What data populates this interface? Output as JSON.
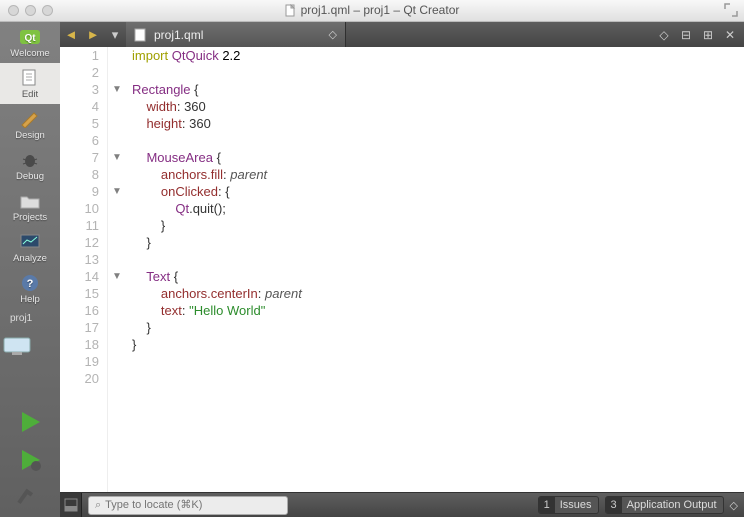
{
  "window": {
    "title": "proj1.qml – proj1 – Qt Creator"
  },
  "sidebar": {
    "items": [
      {
        "id": "welcome",
        "label": "Welcome"
      },
      {
        "id": "edit",
        "label": "Edit"
      },
      {
        "id": "design",
        "label": "Design"
      },
      {
        "id": "debug",
        "label": "Debug"
      },
      {
        "id": "projects",
        "label": "Projects"
      },
      {
        "id": "analyze",
        "label": "Analyze"
      },
      {
        "id": "help",
        "label": "Help"
      }
    ],
    "project_label": "proj1"
  },
  "tabs": {
    "file_name": "proj1.qml"
  },
  "locator": {
    "placeholder": "Type to locate (⌘K)"
  },
  "bottom_panels": {
    "issues": {
      "num": "1",
      "label": "Issues"
    },
    "app_output": {
      "num": "3",
      "label": "Application Output"
    }
  },
  "editor": {
    "lines": [
      {
        "n": 1,
        "tokens": [
          [
            "kw",
            "import"
          ],
          [
            "",
            ""
          ],
          [
            "type",
            " QtQuick"
          ],
          [
            "",
            " 2.2"
          ]
        ]
      },
      {
        "n": 2,
        "tokens": []
      },
      {
        "n": 3,
        "fold": true,
        "tokens": [
          [
            "type",
            "Rectangle"
          ],
          [
            "",
            " "
          ],
          [
            "punct",
            "{"
          ]
        ]
      },
      {
        "n": 4,
        "tokens": [
          [
            "",
            "    "
          ],
          [
            "prop",
            "width"
          ],
          [
            "punct",
            ":"
          ],
          [
            "",
            " "
          ],
          [
            "num",
            "360"
          ]
        ]
      },
      {
        "n": 5,
        "tokens": [
          [
            "",
            "    "
          ],
          [
            "prop",
            "height"
          ],
          [
            "punct",
            ":"
          ],
          [
            "",
            " "
          ],
          [
            "num",
            "360"
          ]
        ]
      },
      {
        "n": 6,
        "tokens": []
      },
      {
        "n": 7,
        "fold": true,
        "tokens": [
          [
            "",
            "    "
          ],
          [
            "type",
            "MouseArea"
          ],
          [
            "",
            " "
          ],
          [
            "punct",
            "{"
          ]
        ]
      },
      {
        "n": 8,
        "tokens": [
          [
            "",
            "        "
          ],
          [
            "prop",
            "anchors.fill"
          ],
          [
            "punct",
            ":"
          ],
          [
            "",
            " "
          ],
          [
            "val-it",
            "parent"
          ]
        ]
      },
      {
        "n": 9,
        "fold": true,
        "tokens": [
          [
            "",
            "        "
          ],
          [
            "prop",
            "onClicked"
          ],
          [
            "punct",
            ":"
          ],
          [
            "",
            " "
          ],
          [
            "punct",
            "{"
          ]
        ]
      },
      {
        "n": 10,
        "tokens": [
          [
            "",
            "            "
          ],
          [
            "type",
            "Qt"
          ],
          [
            "punct",
            ".quit();"
          ]
        ]
      },
      {
        "n": 11,
        "tokens": [
          [
            "",
            "        "
          ],
          [
            "punct",
            "}"
          ]
        ]
      },
      {
        "n": 12,
        "tokens": [
          [
            "",
            "    "
          ],
          [
            "punct",
            "}"
          ]
        ]
      },
      {
        "n": 13,
        "tokens": []
      },
      {
        "n": 14,
        "fold": true,
        "tokens": [
          [
            "",
            "    "
          ],
          [
            "type",
            "Text"
          ],
          [
            "",
            " "
          ],
          [
            "punct",
            "{"
          ]
        ]
      },
      {
        "n": 15,
        "tokens": [
          [
            "",
            "        "
          ],
          [
            "prop",
            "anchors.centerIn"
          ],
          [
            "punct",
            ":"
          ],
          [
            "",
            " "
          ],
          [
            "val-it",
            "parent"
          ]
        ]
      },
      {
        "n": 16,
        "tokens": [
          [
            "",
            "        "
          ],
          [
            "prop",
            "text"
          ],
          [
            "punct",
            ":"
          ],
          [
            "",
            " "
          ],
          [
            "str",
            "\"Hello World\""
          ]
        ]
      },
      {
        "n": 17,
        "tokens": [
          [
            "",
            "    "
          ],
          [
            "punct",
            "}"
          ]
        ]
      },
      {
        "n": 18,
        "tokens": [
          [
            "punct",
            "}"
          ]
        ]
      },
      {
        "n": 19,
        "tokens": []
      },
      {
        "n": 20,
        "tokens": []
      }
    ]
  },
  "active_sidebar": "edit"
}
